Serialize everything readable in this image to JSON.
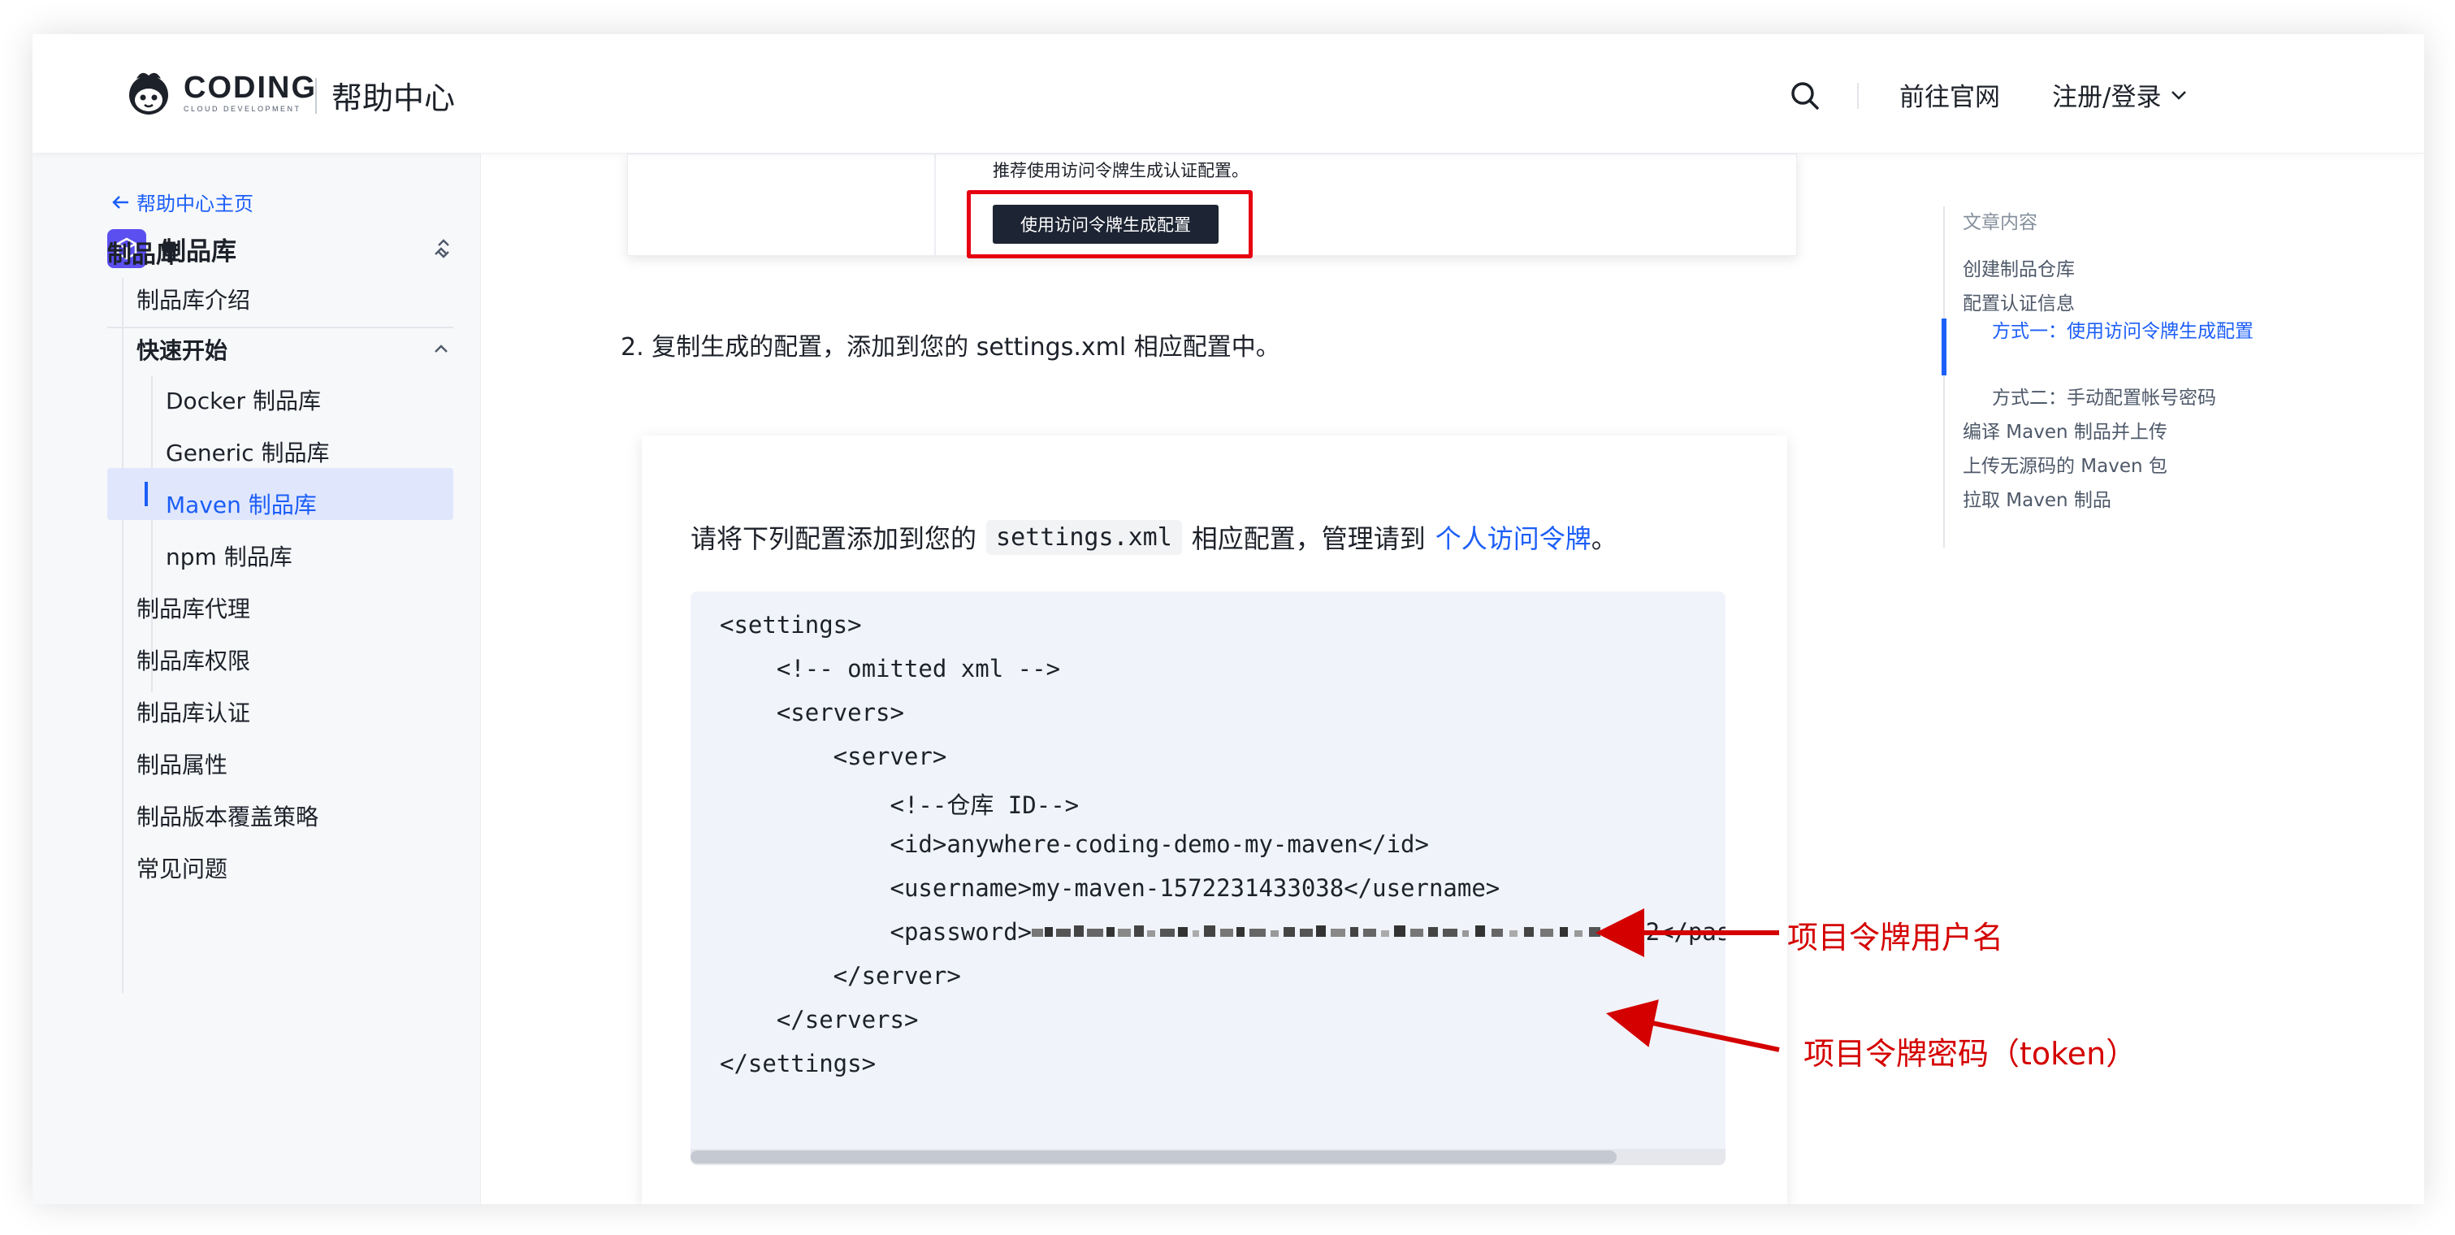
{
  "header": {
    "logo_word": "CODING",
    "logo_sub": "CLOUD DEVELOPMENT",
    "title": "帮助中心",
    "nav_official": "前往官网",
    "nav_login": "注册/登录"
  },
  "sidebar": {
    "back_label": "帮助中心主页",
    "product_name": "制品库",
    "section_title": "制品库",
    "items": [
      {
        "label": "制品库介绍"
      },
      {
        "label": "快速开始"
      },
      {
        "label": "Docker 制品库"
      },
      {
        "label": "Generic 制品库"
      },
      {
        "label": "Maven 制品库"
      },
      {
        "label": "npm 制品库"
      },
      {
        "label": "制品库代理"
      },
      {
        "label": "制品库权限"
      },
      {
        "label": "制品库认证"
      },
      {
        "label": "制品属性"
      },
      {
        "label": "制品版本覆盖策略"
      },
      {
        "label": "常见问题"
      }
    ]
  },
  "main": {
    "img1_hint": "推荐使用访问令牌生成认证配置。",
    "img1_button": "使用访问令牌生成配置",
    "step2": "2. 复制生成的配置，添加到您的 settings.xml 相应配置中。",
    "card2": {
      "prefix": "请将下列配置添加到您的",
      "code": "settings.xml",
      "middle": "相应配置，管理请到",
      "link": "个人访问令牌",
      "suffix": "。"
    },
    "code_lines": [
      "<settings>",
      "    <!-- omitted xml -->",
      "    <servers>",
      "        <server>",
      "            <!--仓库 ID-->",
      "            <id>anywhere-coding-demo-my-maven</id>",
      "            <username>my-maven-1572231433038</username>",
      "            <password>",
      "        </server>",
      "    </servers>",
      "</settings>"
    ],
    "password_tail": ".2</pas",
    "annotation_username": "项目令牌用户名",
    "annotation_password": "项目令牌密码（token）"
  },
  "toc": {
    "title": "文章内容",
    "items": [
      {
        "label": "创建制品仓库"
      },
      {
        "label": "配置认证信息"
      },
      {
        "label": "方式一：使用访问令牌生成配置"
      },
      {
        "label": "方式二：手动配置帐号密码"
      },
      {
        "label": "编译 Maven 制品并上传"
      },
      {
        "label": "上传无源码的 Maven 包"
      },
      {
        "label": "拉取 Maven 制品"
      }
    ]
  },
  "colors": {
    "accent": "#1c5ef7",
    "product_icon": "#5b4ff0",
    "annotation": "#d40000",
    "active_bg": "#e0e7fd",
    "code_bg": "#f0f3f9"
  },
  "icons": [
    "coding-logo-icon",
    "search-icon",
    "chevron-down-icon",
    "arrow-left-icon",
    "cube-icon",
    "expand-collapse-icon",
    "chevron-up-icon",
    "red-arrow-icon"
  ]
}
